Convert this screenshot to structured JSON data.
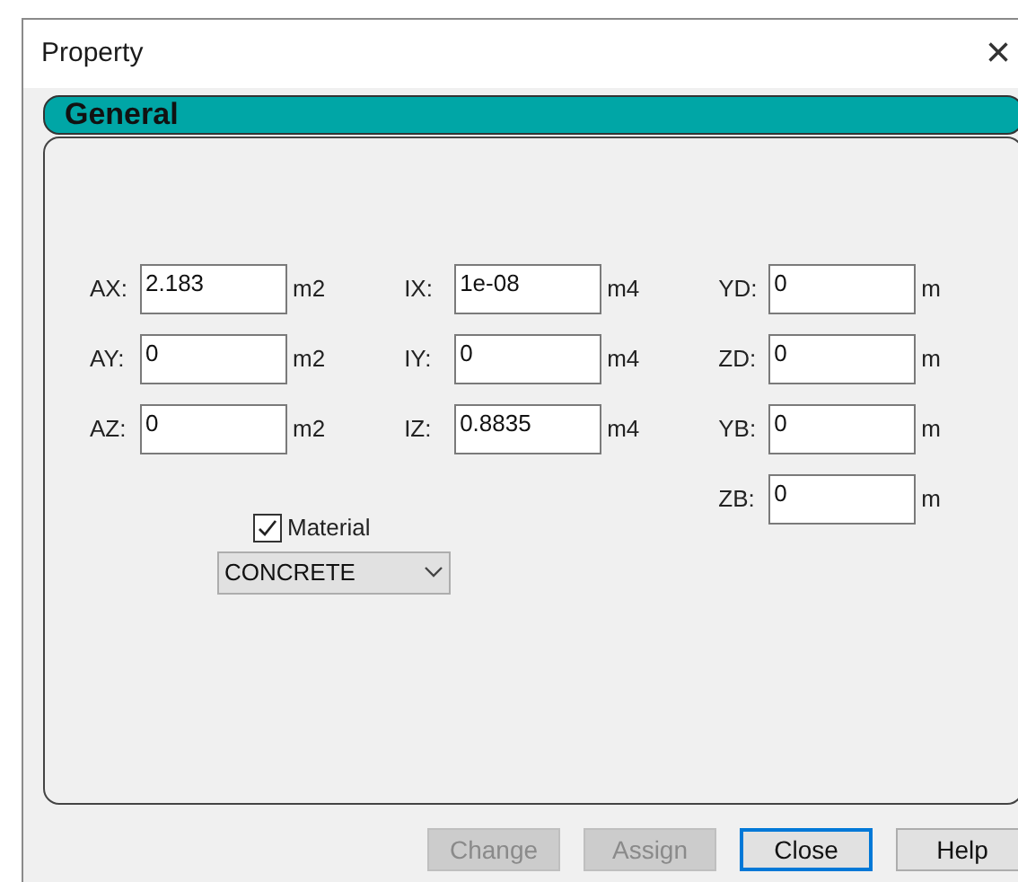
{
  "window": {
    "title": "Property",
    "close": "×"
  },
  "group": {
    "title": "General"
  },
  "field_columns": [
    [
      {
        "label": "AX:",
        "value": "2.183",
        "unit": "m2"
      },
      {
        "label": "AY:",
        "value": "0",
        "unit": "m2"
      },
      {
        "label": "AZ:",
        "value": "0",
        "unit": "m2"
      }
    ],
    [
      {
        "label": "IX:",
        "value": "1e-08",
        "unit": "m4"
      },
      {
        "label": "IY:",
        "value": "0",
        "unit": "m4"
      },
      {
        "label": "IZ:",
        "value": "0.8835",
        "unit": "m4"
      }
    ],
    [
      {
        "label": "YD:",
        "value": "0",
        "unit": "m"
      },
      {
        "label": "ZD:",
        "value": "0",
        "unit": "m"
      },
      {
        "label": "YB:",
        "value": "0",
        "unit": "m"
      },
      {
        "label": "ZB:",
        "value": "0",
        "unit": "m"
      }
    ]
  ],
  "material": {
    "label": "Material",
    "checked": true,
    "value": "CONCRETE"
  },
  "buttons": [
    {
      "label": "Change",
      "disabled": true,
      "default": false
    },
    {
      "label": "Assign",
      "disabled": true,
      "default": false
    },
    {
      "label": "Close",
      "disabled": false,
      "default": true
    },
    {
      "label": "Help",
      "disabled": false,
      "default": false
    }
  ]
}
